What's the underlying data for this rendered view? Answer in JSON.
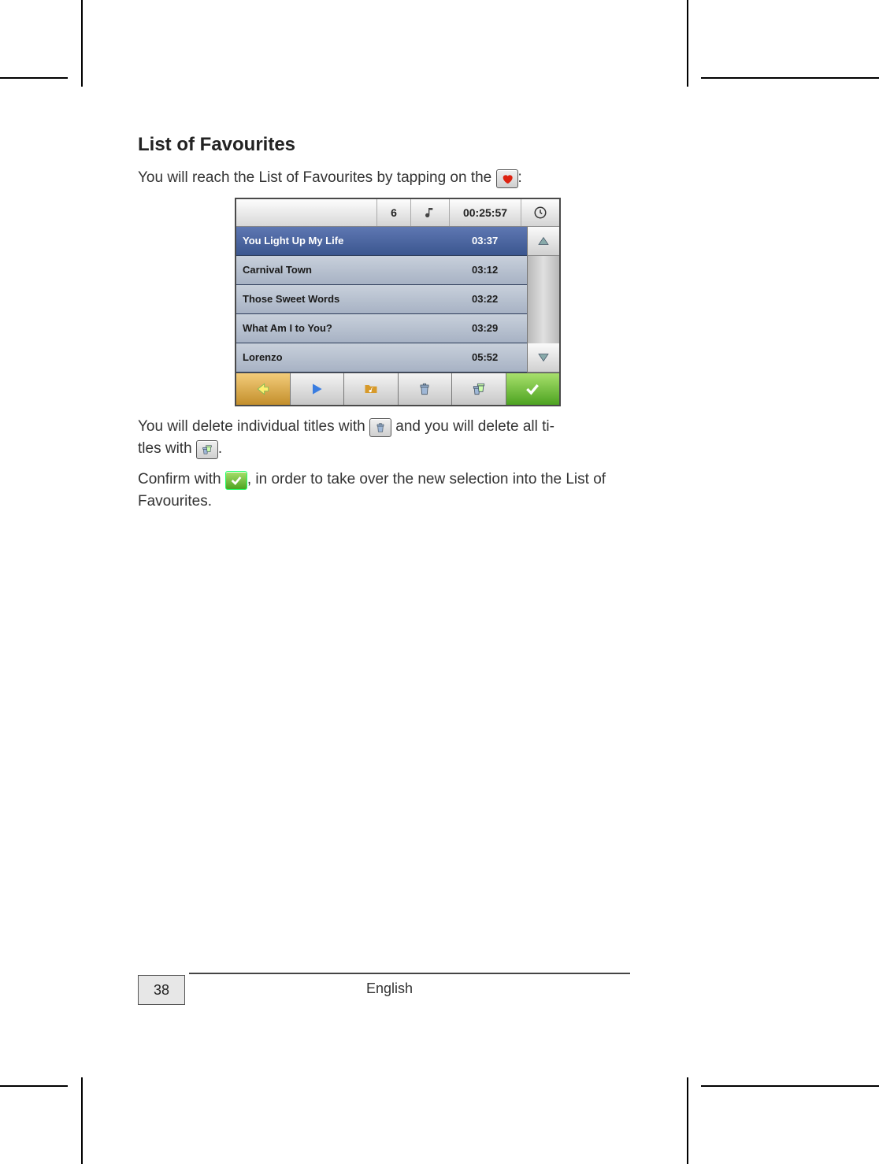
{
  "section_title": "List of Favourites",
  "intro_pre": "You will reach the List of Favourites by tapping on the ",
  "intro_post": ":",
  "device": {
    "track_count": "6",
    "total_time": "00:25:57",
    "tracks": [
      {
        "title": "You Light Up My Life",
        "duration": "03:37",
        "selected": true
      },
      {
        "title": "Carnival Town",
        "duration": "03:12",
        "selected": false
      },
      {
        "title": "Those Sweet Words",
        "duration": "03:22",
        "selected": false
      },
      {
        "title": "What Am I to You?",
        "duration": "03:29",
        "selected": false
      },
      {
        "title": "Lorenzo",
        "duration": "05:52",
        "selected": false
      }
    ]
  },
  "para2_a": "You will delete individual titles with ",
  "para2_b": " and you will delete all ti",
  "para2_c": "tles with ",
  "para2_d": ".",
  "para3_a": "Confirm with ",
  "para3_b": ", in order to take over the new selection into the List of Favourites.",
  "footer": {
    "page_number": "38",
    "language": "English"
  }
}
